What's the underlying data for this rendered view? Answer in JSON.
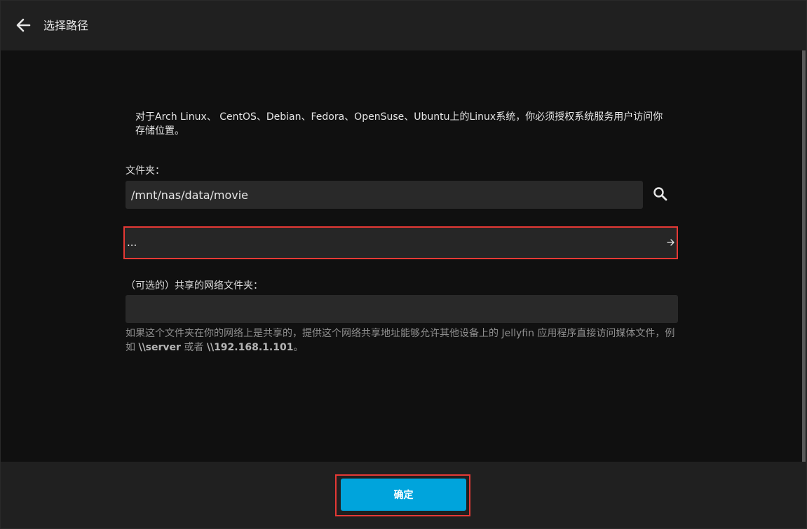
{
  "header": {
    "title": "选择路径",
    "back_icon": "arrow-left-icon"
  },
  "content": {
    "info_text": "对于Arch Linux、 CentOS、Debian、Fedora、OpenSuse、Ubuntu上的Linux系统，你必须授权系统服务用户访问你存储位置。",
    "folder_label": "文件夹：",
    "folder_value": "/mnt/nas/data/movie",
    "search_icon": "search-icon",
    "directory_item_label": "...",
    "directory_item_icon": "arrow-right-icon",
    "network_label": "（可选的）共享的网络文件夹：",
    "network_value": "",
    "help_text_part1": "如果这个文件夹在你的网络上是共享的，提供这个网络共享地址能够允许其他设备上的 Jellyfin 应用程序直接访问媒体文件，例如 ",
    "help_example1": "\\\\server",
    "help_text_part2": " 或者 ",
    "help_example2": "\\\\192.168.1.101",
    "help_text_part3": "。"
  },
  "footer": {
    "confirm_label": "确定"
  },
  "colors": {
    "accent": "#00a4dc",
    "highlight": "#e53935",
    "background": "#101010",
    "panel": "#202020",
    "input": "#292929"
  }
}
